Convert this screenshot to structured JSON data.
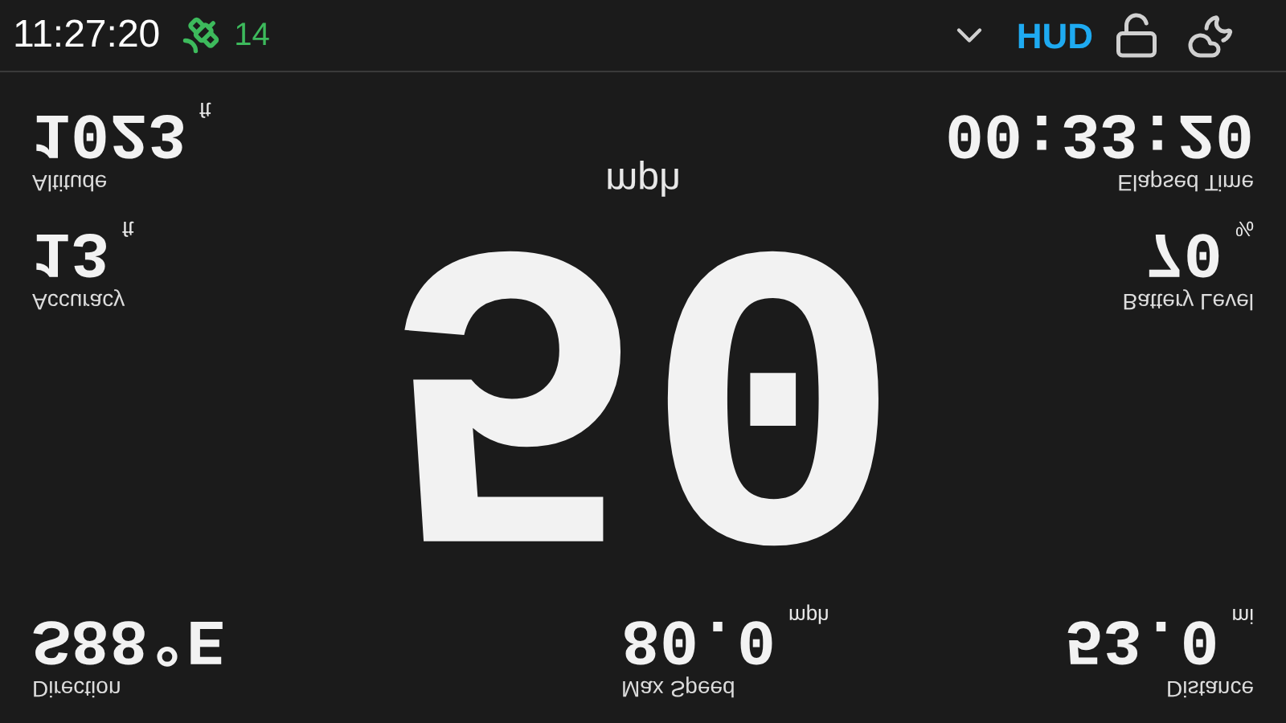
{
  "status_bar": {
    "time": "11:27:20",
    "satellites": "14",
    "mode": "HUD",
    "locked": false
  },
  "mirrored": true,
  "speed": {
    "value": "50",
    "unit": "mph"
  },
  "left": [
    {
      "label": "Altitude",
      "value": "1023",
      "unit": "ft"
    },
    {
      "label": "Accuracy",
      "value": "13",
      "unit": "ft"
    }
  ],
  "right": [
    {
      "label": "Elapsed Time",
      "value": "00:33:20"
    },
    {
      "label": "Battery Level",
      "value": "70",
      "unit": "%"
    }
  ],
  "bottom": [
    {
      "label": "Direction",
      "value": "S88°E"
    },
    {
      "label": "Max Speed",
      "value": "80.0",
      "unit": "mph"
    },
    {
      "label": "Distance",
      "value": "53.0",
      "unit": "mi"
    }
  ]
}
